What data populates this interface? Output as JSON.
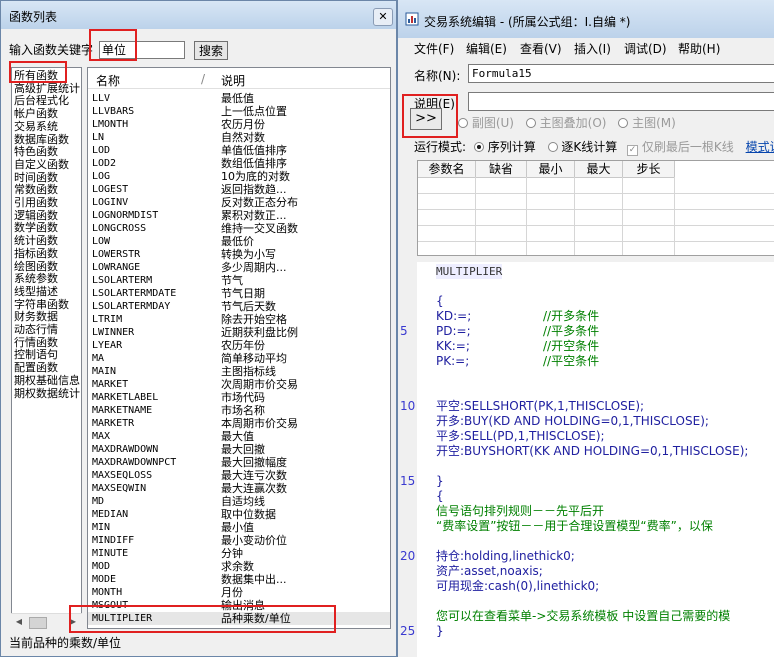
{
  "func_dialog": {
    "title": "函数列表",
    "close_glyph": "✕",
    "keyword_label": "输入函数关键字",
    "keyword_value": "单位",
    "search_button": "搜索",
    "categories": [
      "所有函数",
      "高级扩展统计",
      "后台程式化",
      "帐户函数",
      "交易系统",
      "数据库函数",
      "特色函数",
      "自定义函数",
      "时间函数",
      "常数函数",
      "引用函数",
      "逻辑函数",
      "数学函数",
      "统计函数",
      "指标函数",
      "绘图函数",
      "系统参数",
      "线型描述",
      "字符串函数",
      "财务数据",
      "动态行情",
      "行情函数",
      "控制语句",
      "配置函数",
      "期权基础信息",
      "期权数据统计"
    ],
    "col_name": "名称",
    "col_sep": "/",
    "col_desc": "说明",
    "functions": [
      {
        "name": "LLV",
        "desc": "最低值"
      },
      {
        "name": "LLVBARS",
        "desc": "上一低点位置"
      },
      {
        "name": "LMONTH",
        "desc": "农历月份"
      },
      {
        "name": "LN",
        "desc": "自然对数"
      },
      {
        "name": "LOD",
        "desc": "单值低值排序"
      },
      {
        "name": "LOD2",
        "desc": "数组低值排序"
      },
      {
        "name": "LOG",
        "desc": "10为底的对数"
      },
      {
        "name": "LOGEST",
        "desc": "返回指数趋..."
      },
      {
        "name": "LOGINV",
        "desc": "反对数正态分布"
      },
      {
        "name": "LOGNORMDIST",
        "desc": "累积对数正..."
      },
      {
        "name": "LONGCROSS",
        "desc": "维持一交叉函数"
      },
      {
        "name": "LOW",
        "desc": "最低价"
      },
      {
        "name": "LOWERSTR",
        "desc": "转换为小写"
      },
      {
        "name": "LOWRANGE",
        "desc": "多少周期内..."
      },
      {
        "name": "LSOLARTERM",
        "desc": "节气"
      },
      {
        "name": "LSOLARTERMDATE",
        "desc": "节气日期"
      },
      {
        "name": "LSOLARTERMDAY",
        "desc": "节气后天数"
      },
      {
        "name": "LTRIM",
        "desc": "除去开始空格"
      },
      {
        "name": "LWINNER",
        "desc": "近期获利盘比例"
      },
      {
        "name": "LYEAR",
        "desc": "农历年份"
      },
      {
        "name": "MA",
        "desc": "简单移动平均"
      },
      {
        "name": "MAIN",
        "desc": "主图指标线"
      },
      {
        "name": "MARKET",
        "desc": "次周期市价交易"
      },
      {
        "name": "MARKETLABEL",
        "desc": "市场代码"
      },
      {
        "name": "MARKETNAME",
        "desc": "市场名称"
      },
      {
        "name": "MARKETR",
        "desc": "本周期市价交易"
      },
      {
        "name": "MAX",
        "desc": "最大值"
      },
      {
        "name": "MAXDRAWDOWN",
        "desc": "最大回撤"
      },
      {
        "name": "MAXDRAWDOWNPCT",
        "desc": "最大回撤幅度"
      },
      {
        "name": "MAXSEQLOSS",
        "desc": "最大连亏次数"
      },
      {
        "name": "MAXSEQWIN",
        "desc": "最大连赢次数"
      },
      {
        "name": "MD",
        "desc": "自适均线"
      },
      {
        "name": "MEDIAN",
        "desc": "取中位数据"
      },
      {
        "name": "MIN",
        "desc": "最小值"
      },
      {
        "name": "MINDIFF",
        "desc": "最小变动价位"
      },
      {
        "name": "MINUTE",
        "desc": "分钟"
      },
      {
        "name": "MOD",
        "desc": "求余数"
      },
      {
        "name": "MODE",
        "desc": "数据集中出..."
      },
      {
        "name": "MONTH",
        "desc": "月份"
      },
      {
        "name": "MSGOUT",
        "desc": "输出消息"
      },
      {
        "name": "MULTIPLIER",
        "desc": "品种乘数/单位"
      }
    ],
    "status_text": "当前品种的乘数/单位"
  },
  "editor": {
    "title": "交易系统编辑 - (所属公式组：I.自编 *)",
    "menu": [
      "文件(F)",
      "编辑(E)",
      "查看(V)",
      "插入(I)",
      "调试(D)",
      "帮助(H)"
    ],
    "name_label": "名称(N):",
    "name_value": "Formula15",
    "desc_label": "说明(E):",
    "expand_button": ">>",
    "radio_sub": "副图(U)",
    "radio_main_overlay": "主图叠加(O)",
    "radio_main": "主图(M)",
    "run_mode_label": "运行模式:",
    "run_seq": "序列计算",
    "run_bar": "逐K线计算",
    "only_last": "仅刷最后一根K线",
    "template_link": "模式说",
    "param_headers": [
      "参数名",
      "缺省",
      "最小",
      "最大",
      "步长"
    ],
    "line_numbers": [
      "5",
      "10",
      "15",
      "20",
      "25"
    ],
    "code_lines": [
      "MULTIPLIER",
      "",
      "{",
      "KD:=;",
      "PD:=;",
      "KK:=;",
      "PK:=;",
      "",
      "",
      "平空:SELLSHORT(PK,1,THISCLOSE);",
      "开多:BUY(KD AND HOLDING=0,1,THISCLOSE);",
      "平多:SELL(PD,1,THISCLOSE);",
      "开空:BUYSHORT(KK AND HOLDING=0,1,THISCLOSE);",
      "",
      "}",
      "{",
      "信号语句排列规则－－先平后开",
      "“费率设置”按钮－－用于合理设置模型“费率”，以保",
      "",
      "持仓:holding,linethick0;",
      "资产:asset,noaxis;",
      "可用现金:cash(0),linethick0;",
      "",
      "您可以在查看菜单->交易系统模板 中设置自己需要的模",
      "}"
    ],
    "comments": [
      "//开多条件",
      "//平多条件",
      "//开空条件",
      "//平空条件"
    ]
  }
}
